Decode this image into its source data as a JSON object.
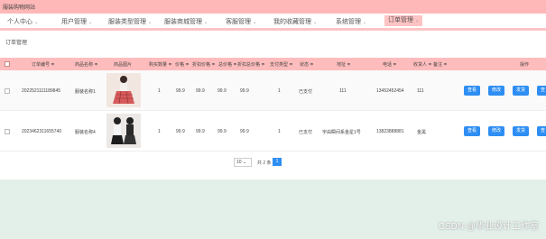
{
  "site_title": "服装购物网站",
  "nav": [
    {
      "label": "个人中心"
    },
    {
      "label": "用户管理"
    },
    {
      "label": "服装类型管理"
    },
    {
      "label": "服装商城管理"
    },
    {
      "label": "客服管理"
    },
    {
      "label": "我的收藏管理"
    },
    {
      "label": "系统管理"
    },
    {
      "label": "订单管理"
    }
  ],
  "page_title": "订单管理",
  "table": {
    "headers": [
      "订单编号 ≑",
      "商品名称 ≑",
      "商品图片",
      "购买数量 ≑",
      "价格 ≑",
      "折扣价格 ≑",
      "总价格 ≑",
      "折扣总价格 ≑",
      "支付类型 ≑",
      "状态 ≑",
      "地址 ≑",
      "电话 ≑",
      "收货人 ≑",
      "备注 ≑",
      "操作"
    ],
    "rows": [
      {
        "order_no": "2022521111189845",
        "name": "服装名称1",
        "qty": "1",
        "price": "99.9",
        "disc_price": "99.9",
        "total": "99.9",
        "disc_total": "99.9",
        "pay_type": "1",
        "status": "已支付",
        "address": "111",
        "phone": "13452452454",
        "receiver": "111",
        "note": ""
      },
      {
        "order_no": "2023462311655740",
        "name": "服装名称4",
        "qty": "1",
        "price": "99.9",
        "disc_price": "99.9",
        "total": "99.9",
        "disc_total": "99.9",
        "pay_type": "1",
        "status": "已支付",
        "address": "宇由瞬间系金星1号",
        "phone": "13823888881",
        "receiver": "金黑",
        "note": ""
      }
    ],
    "actions": [
      "查看",
      "修改",
      "发货",
      "查看"
    ]
  },
  "pager": {
    "page_size": "10",
    "total": "共 2 条",
    "current": "1"
  },
  "watermark": "CSDN @毕业设计工作室"
}
